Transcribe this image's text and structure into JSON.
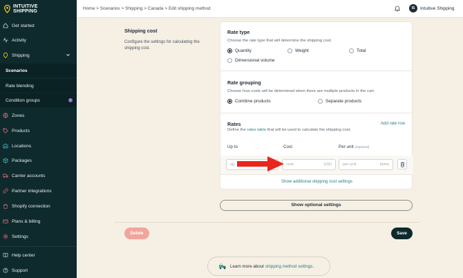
{
  "brand": {
    "line1": "INTUITIVE",
    "line2": "SHIPPING",
    "accent": "#f5c518"
  },
  "sidebar": {
    "items": [
      {
        "label": "Get started",
        "icon": "home-icon"
      },
      {
        "label": "Activity",
        "icon": "activity-icon"
      },
      {
        "label": "Shipping",
        "icon": "map-pin-icon"
      },
      {
        "label": "Scenarios"
      },
      {
        "label": "Rate blending"
      },
      {
        "label": "Condition groups",
        "badge": "i"
      },
      {
        "label": "Zones",
        "icon": "globe-icon"
      },
      {
        "label": "Products",
        "icon": "tag-icon"
      },
      {
        "label": "Locations",
        "icon": "warehouse-icon"
      },
      {
        "label": "Packages",
        "icon": "box-icon"
      },
      {
        "label": "Carrier accounts",
        "icon": "truck-icon"
      },
      {
        "label": "Partner integrations",
        "icon": "link-icon"
      },
      {
        "label": "Shopify connection",
        "icon": "shopify-bag-icon"
      },
      {
        "label": "Plans & billing",
        "icon": "credit-card-icon"
      },
      {
        "label": "Settings",
        "icon": "gear-icon"
      },
      {
        "label": "Help center",
        "icon": "book-icon"
      },
      {
        "label": "Support",
        "icon": "help-circle-icon"
      }
    ]
  },
  "topbar": {
    "breadcrumb": "Home > Scenarios > Shipping > Canada > Edit shipping method",
    "avatar_initials": "IS",
    "account_name": "Intuitive Shipping"
  },
  "shipping_cost": {
    "title": "Shipping cost",
    "description": "Configure the settings for calculating the shipping cost."
  },
  "rate_type": {
    "title": "Rate type",
    "description": "Choose the rate type that will determine the shipping cost.",
    "options": [
      "Quantity",
      "Weight",
      "Total",
      "Dimensional volume"
    ],
    "selected": "Quantity"
  },
  "rate_grouping": {
    "title": "Rate grouping",
    "description": "Choose how costs will be determined when there are multiple products in the cart.",
    "options": [
      "Combine products",
      "Separate products"
    ],
    "selected": "Combine products"
  },
  "rates": {
    "title": "Rates",
    "desc_before": "Define the ",
    "desc_link": "rates table",
    "desc_after": " that will be used to calculate the shipping cost.",
    "add_label": "Add rate row",
    "col_up_to": "Up to",
    "col_cost": "Cost",
    "col_per_unit": "Per unit",
    "col_optional": "(Optional)",
    "up_to_placeholder": "up",
    "cost_placeholder": "cost",
    "cost_suffix": "USD",
    "per_unit_placeholder": "per unit",
    "per_unit_suffix": "items",
    "show_additional": "Show additional shipping cost settings"
  },
  "show_optional_label": "Show optional settings",
  "delete_label": "Delete",
  "save_label": "Save",
  "learn": {
    "before": "Learn more about ",
    "link": "shipping method settings",
    "after": "."
  },
  "colors": {
    "sidebar_bg": "#0e2a2c",
    "page_bg": "#f6efe4",
    "link": "#2c7f86",
    "delete": "#f2a59c",
    "arrow": "#e8261c"
  }
}
